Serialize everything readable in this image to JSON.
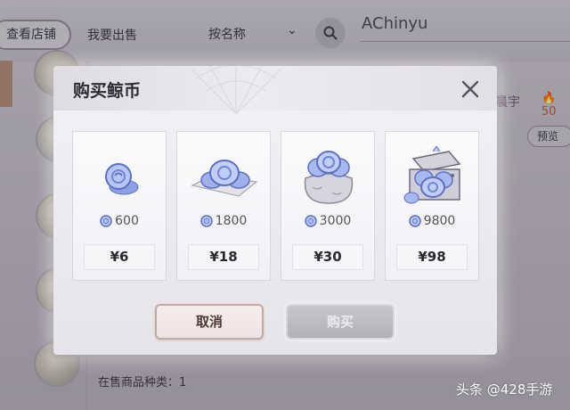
{
  "background": {
    "store_button": "查看店铺",
    "sell_tab": "我要出售",
    "sort_label": "按名称",
    "sort_caret": "⌄",
    "username": "AChinyu",
    "right_name": "晨宇",
    "fire_count": "🔥50",
    "preview_button": "预览",
    "product_count": "在售商品种类：1"
  },
  "watermark": "头条 @428手游",
  "modal": {
    "title": "购买鲸币",
    "close_icon": "close-icon",
    "packages": [
      {
        "amount": "600",
        "price": "¥6",
        "icon": "coin-small-icon"
      },
      {
        "amount": "1800",
        "price": "¥18",
        "icon": "coin-pile-icon"
      },
      {
        "amount": "3000",
        "price": "¥30",
        "icon": "coin-bag-icon"
      },
      {
        "amount": "9800",
        "price": "¥98",
        "icon": "coin-chest-icon"
      }
    ],
    "cancel_label": "取消",
    "buy_label": "购买"
  },
  "colors": {
    "coin_blue": "#6f86d8",
    "cancel_border": "#c7a899",
    "buy_disabled": "#bcbac0"
  }
}
